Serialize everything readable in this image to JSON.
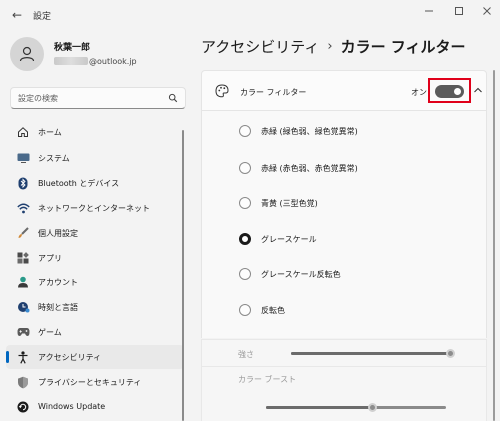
{
  "window": {
    "back_glyph": "←",
    "title": "設定"
  },
  "profile": {
    "name": "秋葉一郎",
    "email": "@outlook.jp"
  },
  "search": {
    "placeholder": "設定の検索"
  },
  "sidebar": {
    "items": [
      {
        "label": "ホーム",
        "icon": "home-icon"
      },
      {
        "label": "システム",
        "icon": "system-icon"
      },
      {
        "label": "Bluetooth とデバイス",
        "icon": "bluetooth-icon"
      },
      {
        "label": "ネットワークとインターネット",
        "icon": "wifi-icon"
      },
      {
        "label": "個人用設定",
        "icon": "brush-icon"
      },
      {
        "label": "アプリ",
        "icon": "apps-icon"
      },
      {
        "label": "アカウント",
        "icon": "account-icon"
      },
      {
        "label": "時刻と言語",
        "icon": "time-language-icon"
      },
      {
        "label": "ゲーム",
        "icon": "gamepad-icon"
      },
      {
        "label": "アクセシビリティ",
        "icon": "accessibility-icon",
        "selected": true
      },
      {
        "label": "プライバシーとセキュリティ",
        "icon": "shield-icon"
      },
      {
        "label": "Windows Update",
        "icon": "update-icon"
      }
    ]
  },
  "breadcrumb": {
    "parent": "アクセシビリティ",
    "separator": "›",
    "current": "カラー フィルター"
  },
  "color_filter": {
    "title": "カラー フィルター",
    "toggle_state": "オン",
    "toggle_on": true,
    "options": [
      {
        "label": "赤緑 (緑色弱、緑色覚異常)",
        "checked": false
      },
      {
        "label": "赤緑 (赤色弱、赤色覚異常)",
        "checked": false
      },
      {
        "label": "青黄 (三型色覚)",
        "checked": false
      },
      {
        "label": "グレースケール",
        "checked": true
      },
      {
        "label": "グレースケール反転色",
        "checked": false
      },
      {
        "label": "反転色",
        "checked": false
      }
    ],
    "intensity_label": "強さ",
    "intensity_value": 1.0,
    "boost_label": "カラー ブースト",
    "boost_value": 0.6
  },
  "colors": {
    "accent": "#0067c0",
    "highlight": "#e0001a",
    "toggle": "#5b5b5b"
  }
}
